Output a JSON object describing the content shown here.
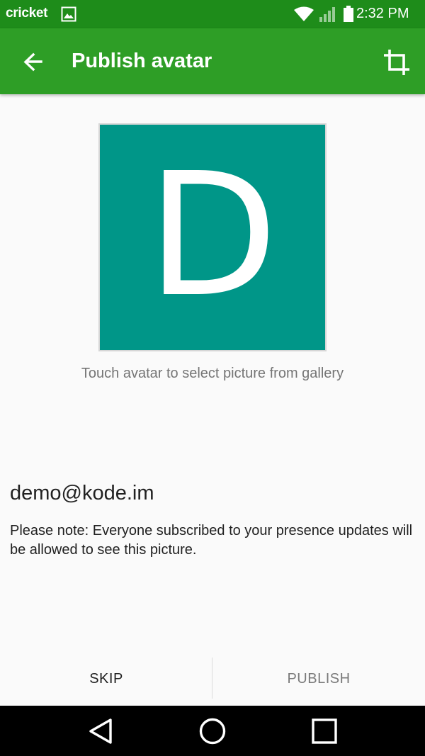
{
  "status_bar": {
    "carrier": "cricket",
    "time": "2:32 PM",
    "icons": [
      "gallery-icon",
      "wifi-icon",
      "signal-icon",
      "battery-icon"
    ]
  },
  "app_bar": {
    "title": "Publish avatar",
    "back_icon": "arrow-back-icon",
    "crop_icon": "crop-icon"
  },
  "avatar": {
    "letter": "D",
    "color": "#009688",
    "hint": "Touch avatar to select picture from gallery"
  },
  "account": {
    "jid": "demo@kode.im",
    "note": "Please note: Everyone subscribed to your presence updates will be allowed to see this picture."
  },
  "buttons": {
    "skip_label": "SKIP",
    "publish_label": "PUBLISH"
  },
  "nav_bar": {
    "icons": [
      "nav-back-icon",
      "nav-home-icon",
      "nav-recents-icon"
    ]
  },
  "colors": {
    "status_bar": "#1e8c1a",
    "app_bar": "#2e9e26",
    "avatar": "#009688",
    "background": "#fafafa"
  }
}
